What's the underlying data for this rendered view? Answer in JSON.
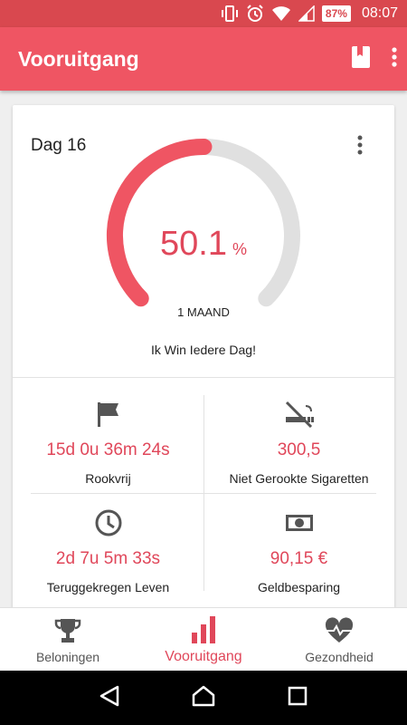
{
  "status_bar": {
    "battery": "87%",
    "time": "08:07"
  },
  "app_bar": {
    "title": "Vooruitgang"
  },
  "card": {
    "day": "Dag 16",
    "progress_value": "50.1",
    "progress_unit": "%",
    "progress_fraction": 0.501,
    "progress_sub": "1 MAAND",
    "motto": "Ik Win Iedere Dag!"
  },
  "stats": [
    {
      "icon": "flag-icon",
      "value": "15d 0u 36m 24s",
      "label": "Rookvrij"
    },
    {
      "icon": "no-smoking-icon",
      "value": "300,5",
      "label": "Niet Gerookte Sigaretten"
    },
    {
      "icon": "clock-icon",
      "value": "2d 7u 5m 33s",
      "label": "Teruggekregen Leven"
    },
    {
      "icon": "money-icon",
      "value": "90,15 €",
      "label": "Geldbesparing"
    }
  ],
  "bottom_nav": [
    {
      "icon": "trophy-icon",
      "label": "Beloningen"
    },
    {
      "icon": "bar-chart-icon",
      "label": "Vooruitgang",
      "active": true
    },
    {
      "icon": "heartbeat-icon",
      "label": "Gezondheid"
    }
  ],
  "colors": {
    "accent": "#ef5563",
    "status": "#d9484f",
    "gauge_track": "#e0e0e0",
    "value_text": "#e0475a"
  }
}
